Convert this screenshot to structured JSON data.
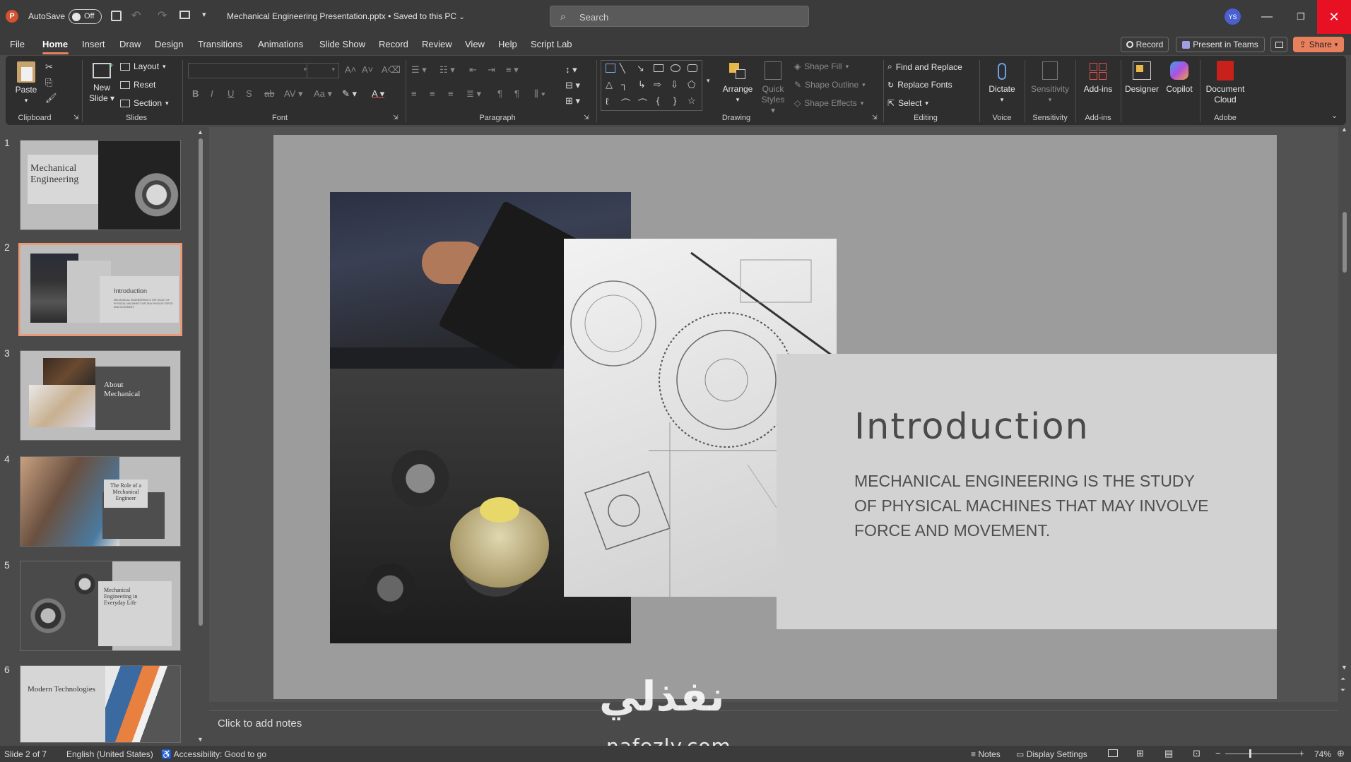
{
  "titlebar": {
    "autosave_label": "AutoSave",
    "autosave_state": "Off",
    "filename": "Mechanical Engineering Presentation.pptx",
    "save_status": "• Saved to this PC",
    "search_placeholder": "Search",
    "avatar_initials": "YS"
  },
  "menu": {
    "items": [
      "File",
      "Home",
      "Insert",
      "Draw",
      "Design",
      "Transitions",
      "Animations",
      "Slide Show",
      "Record",
      "Review",
      "View",
      "Help",
      "Script Lab"
    ],
    "active": "Home",
    "record_button": "Record",
    "present_button": "Present in Teams",
    "share_button": "Share"
  },
  "ribbon": {
    "clipboard": {
      "paste": "Paste",
      "group": "Clipboard"
    },
    "slides": {
      "new_slide_line1": "New",
      "new_slide_line2": "Slide",
      "layout": "Layout",
      "reset": "Reset",
      "section": "Section",
      "group": "Slides"
    },
    "font": {
      "group": "Font"
    },
    "paragraph": {
      "group": "Paragraph"
    },
    "drawing": {
      "arrange": "Arrange",
      "quick_styles_line1": "Quick",
      "quick_styles_line2": "Styles",
      "shape_fill": "Shape Fill",
      "shape_outline": "Shape Outline",
      "shape_effects": "Shape Effects",
      "group": "Drawing"
    },
    "editing": {
      "find_replace": "Find and Replace",
      "replace_fonts": "Replace Fonts",
      "select": "Select",
      "group": "Editing"
    },
    "voice": {
      "dictate": "Dictate",
      "group": "Voice"
    },
    "sensitivity": {
      "button": "Sensitivity",
      "group": "Sensitivity"
    },
    "addins": {
      "button": "Add-ins",
      "group": "Add-ins"
    },
    "designer": "Designer",
    "copilot": "Copilot",
    "adobe": {
      "line1": "Document",
      "line2": "Cloud",
      "group": "Adobe"
    }
  },
  "thumbnails": [
    {
      "number": "1",
      "title": "Mechanical Engineering"
    },
    {
      "number": "2",
      "title": "Introduction",
      "body": "MECHANICAL ENGINEERING IS THE STUDY OF PHYSICAL MACHINES THAT MAY INVOLVE FORCE AND MOVEMENT."
    },
    {
      "number": "3",
      "title": "About Mechanical"
    },
    {
      "number": "4",
      "title": "The Role of a Mechanical Engineer"
    },
    {
      "number": "5",
      "title": "Mechanical Engineering in Everyday Life"
    },
    {
      "number": "6",
      "title": "Modern Technologies"
    }
  ],
  "slide": {
    "title": "Introduction",
    "body_line1": "MECHANICAL ENGINEERING IS THE STUDY",
    "body_line2": "OF PHYSICAL MACHINES THAT MAY INVOLVE",
    "body_line3": "FORCE AND MOVEMENT."
  },
  "notes_placeholder": "Click to add notes",
  "watermark": {
    "arabic": "نفذلي",
    "latin": "nafezly.com"
  },
  "statusbar": {
    "slide_count": "Slide 2 of 7",
    "language": "English (United States)",
    "accessibility": "Accessibility: Good to go",
    "notes": "Notes",
    "display_settings": "Display Settings",
    "zoom": "74%"
  },
  "colors": {
    "accent": "#e8805e",
    "selection_border": "#e89b7a",
    "close_red": "#e81123"
  }
}
